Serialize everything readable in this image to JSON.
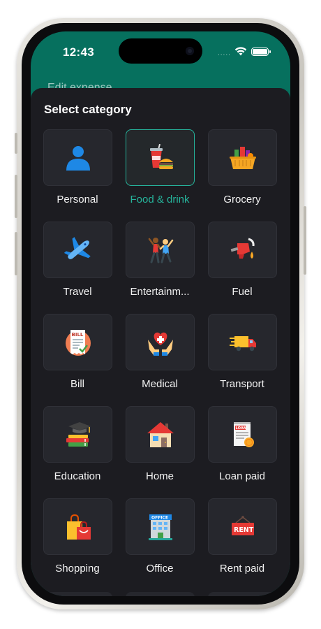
{
  "status": {
    "time": "12:43",
    "signal": "....."
  },
  "behind": {
    "title": "Edit expense"
  },
  "sheet": {
    "title": "Select category",
    "selected": "Food & drink",
    "accent": "#26b39b",
    "categories": [
      {
        "label": "Personal",
        "icon": "person-icon"
      },
      {
        "label": "Food & drink",
        "icon": "food-drink-icon"
      },
      {
        "label": "Grocery",
        "icon": "grocery-basket-icon"
      },
      {
        "label": "Travel",
        "icon": "airplane-icon"
      },
      {
        "label": "Entertainm...",
        "icon": "dancing-people-icon"
      },
      {
        "label": "Fuel",
        "icon": "fuel-nozzle-icon"
      },
      {
        "label": "Bill",
        "icon": "bill-receipt-icon"
      },
      {
        "label": "Medical",
        "icon": "heart-hands-icon"
      },
      {
        "label": "Transport",
        "icon": "delivery-truck-icon"
      },
      {
        "label": "Education",
        "icon": "graduation-books-icon"
      },
      {
        "label": "Home",
        "icon": "house-icon"
      },
      {
        "label": "Loan paid",
        "icon": "loan-document-icon"
      },
      {
        "label": "Shopping",
        "icon": "shopping-bags-icon"
      },
      {
        "label": "Office",
        "icon": "office-building-icon"
      },
      {
        "label": "Rent paid",
        "icon": "rent-sign-icon"
      }
    ],
    "icon_text": {
      "bill": "BILL",
      "loan": "LOAN",
      "office": "OFFICE",
      "rent": "RENT"
    }
  }
}
